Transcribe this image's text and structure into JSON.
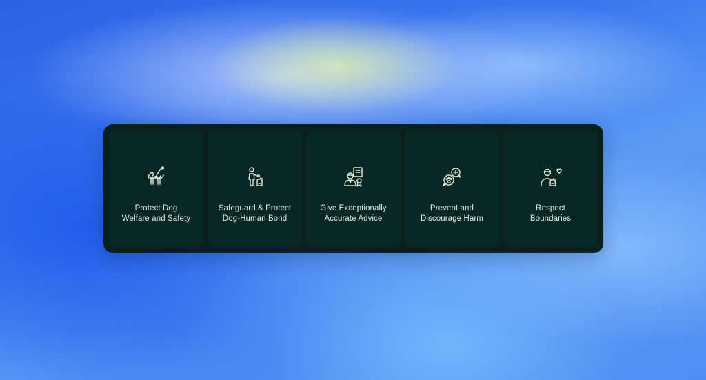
{
  "principles": [
    {
      "icon": "guide-dog-icon",
      "line1": "Protect Dog",
      "line2": "Welfare and Safety"
    },
    {
      "icon": "person-training-dog-icon",
      "line1": "Safeguard & Protect",
      "line2": "Dog-Human Bond"
    },
    {
      "icon": "expert-certificate-icon",
      "line1": "Give Exceptionally",
      "line2": "Accurate Advice"
    },
    {
      "icon": "medical-chat-icon",
      "line1": "Prevent and",
      "line2": "Discourage Harm"
    },
    {
      "icon": "person-with-dog-heart-icon",
      "line1": "Respect",
      "line2": "Boundaries"
    }
  ],
  "colors": {
    "panel": "#0b1f1d",
    "card": "#082826",
    "text": "#dfe8e4",
    "icon_stroke": "#e6ead2"
  }
}
